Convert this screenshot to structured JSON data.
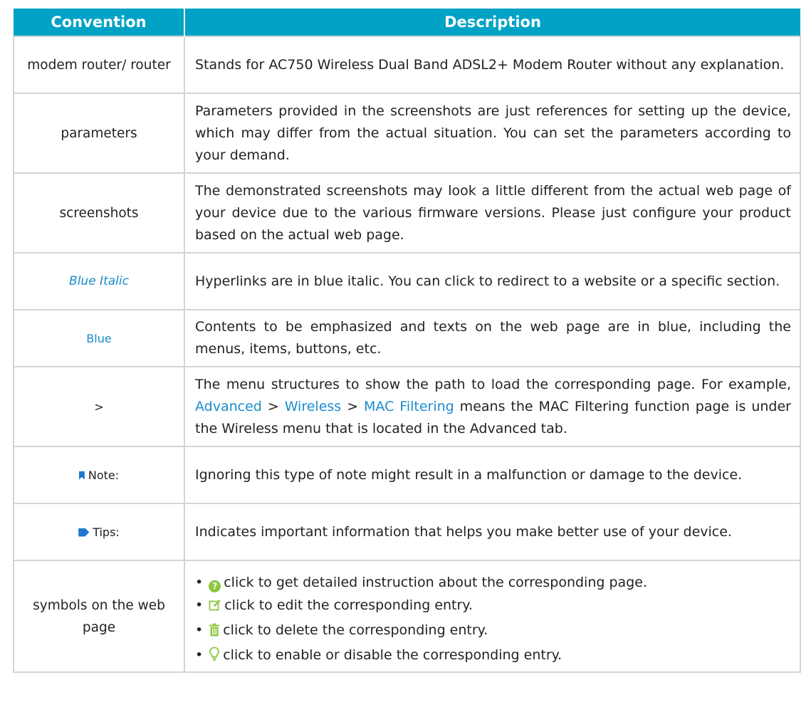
{
  "table": {
    "headers": {
      "convention": "Convention",
      "description": "Description"
    },
    "rows": [
      {
        "convention": "modem router/ router",
        "description": "Stands for AC750 Wireless Dual Band ADSL2+ Modem Router without any explanation."
      },
      {
        "convention": "parameters",
        "description": "Parameters provided in the screenshots are just references for setting up the device, which may differ from the actual situation. You can set the parameters according to your demand."
      },
      {
        "convention": "screenshots",
        "description": "The demonstrated screenshots may look a little different from the actual web page of your device due to the various firmware versions. Please just configure your product based on the actual web page."
      },
      {
        "convention": "Blue Italic",
        "description": "Hyperlinks are in blue italic. You can click to redirect to a website or a specific section."
      },
      {
        "convention": "Blue",
        "description": "Contents to be emphasized and texts on the web page are in blue, including the menus, items, buttons, etc."
      },
      {
        "convention": ">",
        "description_prefix": "The menu structures to show the path to load the corresponding page. For example, ",
        "path": [
          "Advanced",
          "Wireless",
          "MAC Filtering"
        ],
        "separator": ">",
        "description_suffix": " means the MAC Filtering function page is under the Wireless menu that is located in the Advanced tab."
      },
      {
        "convention": "Note:",
        "icon": "bookmark-icon",
        "description": "Ignoring this type of note might result in a malfunction or damage to the device."
      },
      {
        "convention": "Tips:",
        "icon": "tag-icon",
        "description": "Indicates important information that helps you make better use of your device."
      },
      {
        "convention": "symbols on the web page",
        "symbols": [
          {
            "icon": "help-icon",
            "text": "click to get detailed instruction about the corresponding page."
          },
          {
            "icon": "edit-icon",
            "text": "click to edit the corresponding entry."
          },
          {
            "icon": "trash-icon",
            "text": "click to delete the corresponding entry."
          },
          {
            "icon": "bulb-icon",
            "text": "click to enable or disable the corresponding entry."
          }
        ]
      }
    ]
  },
  "colors": {
    "header_bg": "#00a2c6",
    "link_blue": "#1b8ccc",
    "icon_blue": "#1f78d0",
    "icon_green": "#8cc63f",
    "border": "#d4d4d4"
  }
}
